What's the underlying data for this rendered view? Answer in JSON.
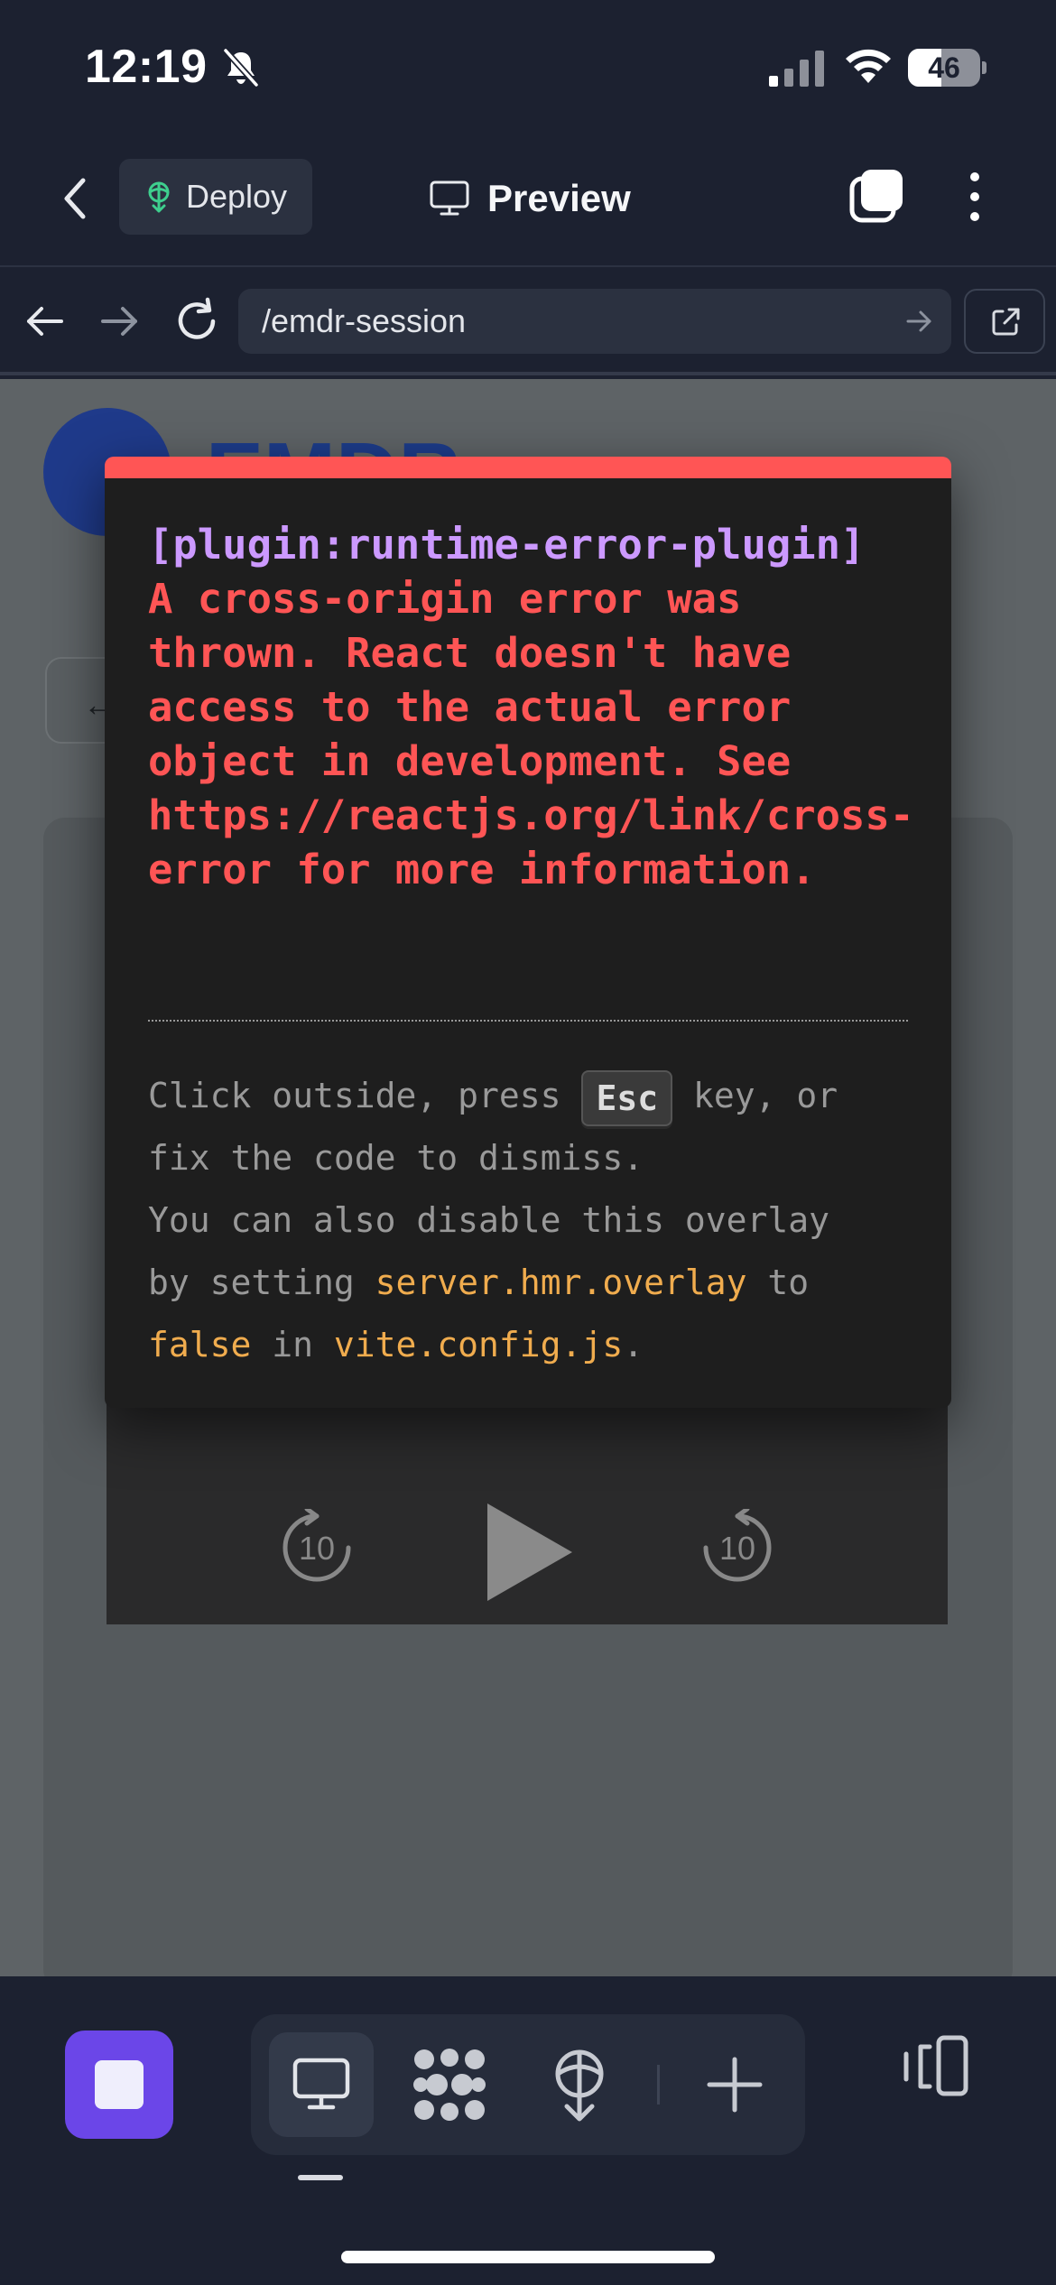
{
  "status_bar": {
    "time": "12:19",
    "battery_level": "46",
    "battery_fraction": 0.46
  },
  "header": {
    "deploy_label": "Deploy",
    "title": "Preview"
  },
  "browser": {
    "url": "/emdr-session"
  },
  "web_page": {
    "brand_text": "EMDR..."
  },
  "error_overlay": {
    "plugin": "[plugin:runtime-error-plugin]",
    "message_lines": [
      "A cross-origin error was",
      "thrown. React doesn't have",
      "access to the actual error",
      "object in development. See",
      "https://reactjs.org/link/cross-origin-",
      "error for more information."
    ],
    "tip": {
      "t1": "Click outside, press ",
      "key": "Esc",
      "t2": " key, or",
      "t3": "fix the code to dismiss.",
      "t4": "You can also disable this overlay",
      "t5": "by setting ",
      "code1": "server.hmr.overlay",
      "t6": " to",
      "code2": "false",
      "t7": " in ",
      "code3": "vite.config.js",
      "t8": "."
    }
  },
  "video_controls": {
    "rewind_seconds": "10",
    "forward_seconds": "10"
  },
  "colors": {
    "error_red": "#ff5555",
    "plugin_purple": "#cc99ff",
    "code_yellow": "#f0ac4e",
    "stop_button": "#6b46e8",
    "background": "#1c2130"
  },
  "icons": [
    "back-chevron-icon",
    "deploy-icon",
    "monitor-icon",
    "tabs-icon",
    "more-vertical-icon",
    "arrow-left-icon",
    "arrow-right-icon",
    "reload-icon",
    "external-link-icon",
    "stop-icon",
    "graph-icon",
    "add-icon",
    "panel-toggle-icon"
  ]
}
